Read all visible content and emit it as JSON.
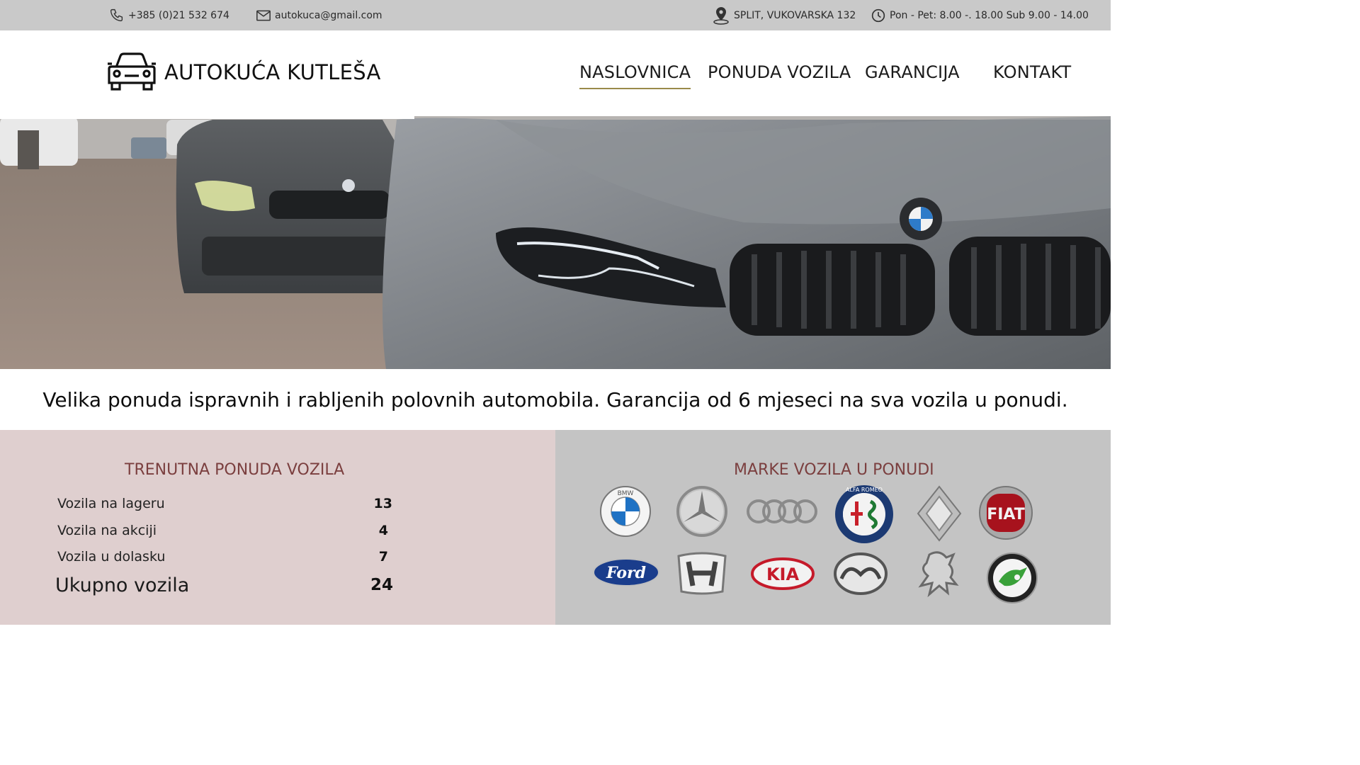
{
  "topbar": {
    "phone": "+385 (0)21 532 674",
    "email": "autokuca@gmail.com",
    "address": "SPLIT, VUKOVARSKA 132",
    "hours": "Pon - Pet: 8.00 -. 18.00 Sub 9.00 - 14.00"
  },
  "header": {
    "brand": "AUTOKUĆA KUTLEŠA",
    "nav": [
      {
        "label": "NASLOVNICA",
        "active": true
      },
      {
        "label": "PONUDA VOZILA",
        "active": false
      },
      {
        "label": "GARANCIJA",
        "active": false
      },
      {
        "label": "KONTAKT",
        "active": false
      }
    ]
  },
  "tagline": "Velika ponuda ispravnih i rabljenih polovnih automobila. Garancija od 6 mjeseci na sva vozila u ponudi.",
  "stats": {
    "title": "TRENUTNA PONUDA VOZILA",
    "rows": [
      {
        "label": "Vozila na lageru",
        "value": "13"
      },
      {
        "label": "Vozila na akciji",
        "value": "4"
      },
      {
        "label": "Vozila u dolasku",
        "value": "7"
      }
    ],
    "total": {
      "label": "Ukupno vozila",
      "value": "24"
    }
  },
  "brands": {
    "title": "MARKE VOZILA U PONUDI",
    "items": [
      {
        "name": "bmw",
        "text": "BMW"
      },
      {
        "name": "mercedes",
        "text": ""
      },
      {
        "name": "audi",
        "text": ""
      },
      {
        "name": "alfa-romeo",
        "text": "ALFA ROMEO"
      },
      {
        "name": "renault",
        "text": ""
      },
      {
        "name": "fiat",
        "text": "FIAT"
      },
      {
        "name": "ford",
        "text": "Ford"
      },
      {
        "name": "honda",
        "text": ""
      },
      {
        "name": "kia",
        "text": "KIA"
      },
      {
        "name": "mazda",
        "text": ""
      },
      {
        "name": "peugeot",
        "text": ""
      },
      {
        "name": "skoda",
        "text": ""
      }
    ]
  },
  "colors": {
    "topbar_bg": "#c9c9c9",
    "stats_bg": "#dfcfcf",
    "brands_bg": "#c4c4c4",
    "panel_title": "#7b3f3f",
    "nav_underline": "#9a8a4a"
  }
}
